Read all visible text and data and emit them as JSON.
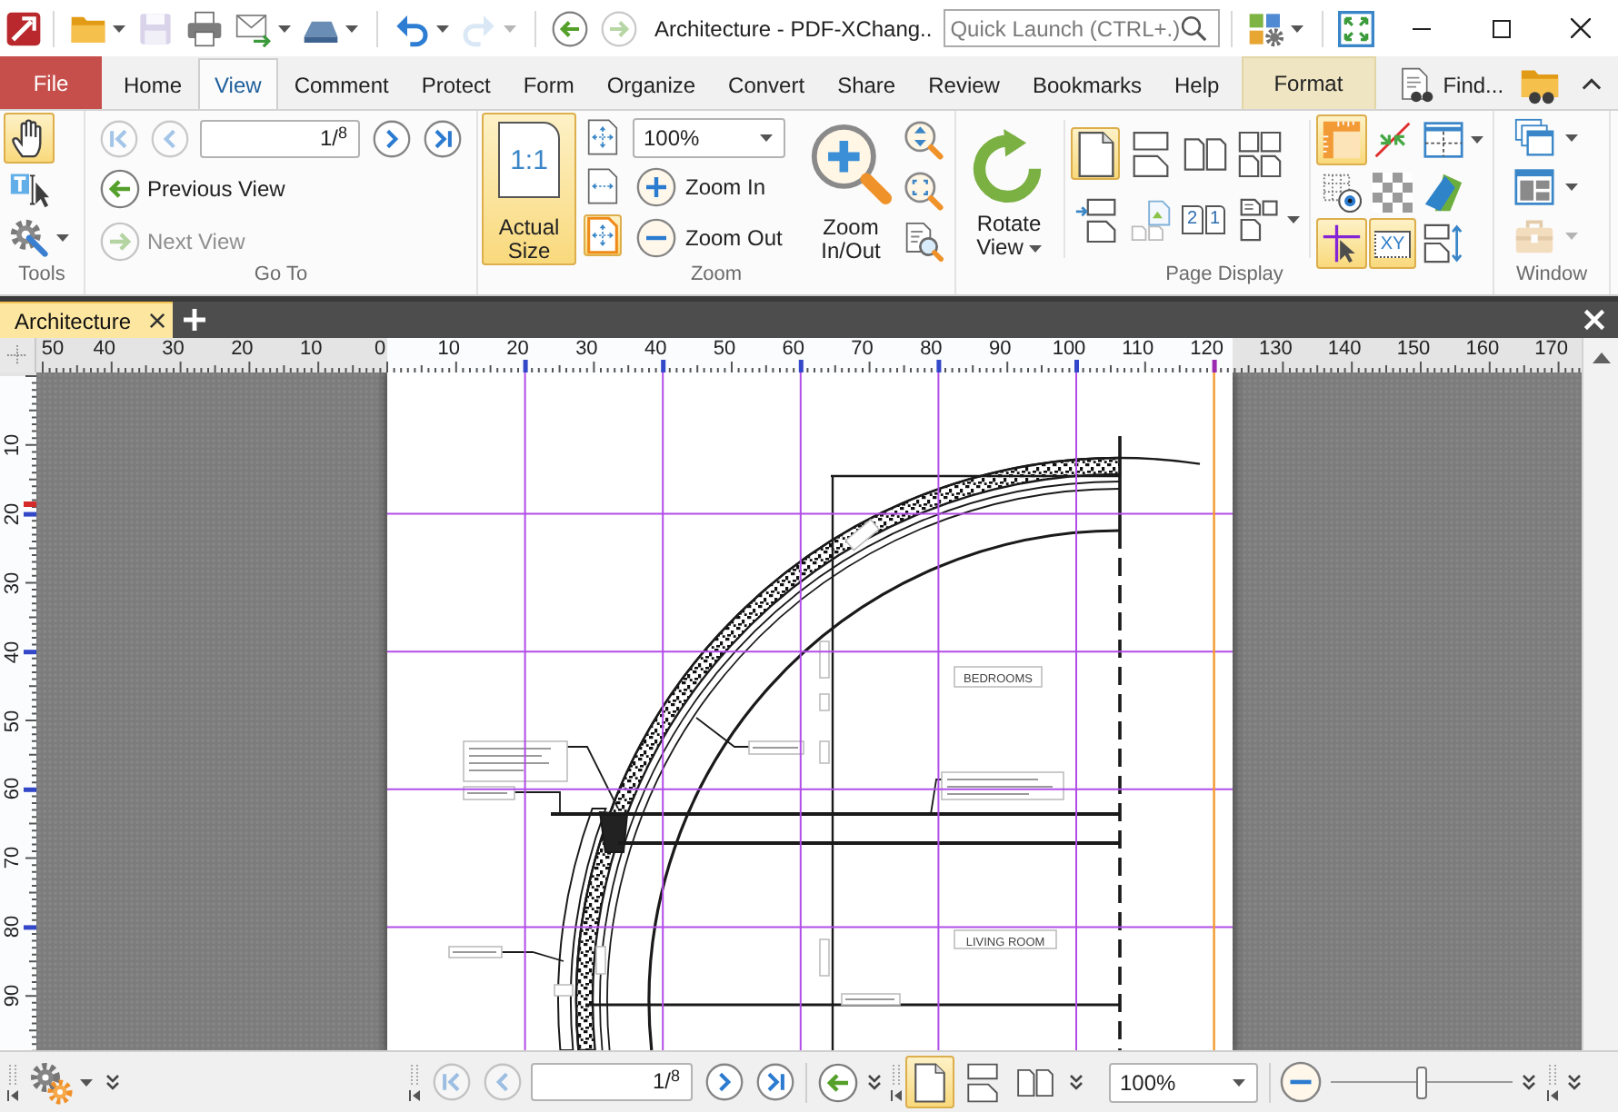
{
  "title_bar": {
    "quick_access": [
      {
        "kind": "open",
        "disabled": false
      },
      {
        "kind": "save",
        "disabled": true
      },
      {
        "kind": "print",
        "disabled": false
      },
      {
        "kind": "email",
        "disabled": false
      },
      {
        "kind": "scan",
        "disabled": false
      },
      {
        "kind": "undo",
        "disabled": false
      },
      {
        "kind": "redo",
        "disabled": true
      },
      {
        "kind": "back",
        "disabled": false
      },
      {
        "kind": "forward",
        "disabled": true
      }
    ],
    "title": "Architecture - PDF-XChang..",
    "quick_launch": {
      "placeholder": "Quick Launch (CTRL+.)"
    }
  },
  "ribbon_tabs": [
    {
      "label": "File",
      "kind": "file",
      "selected": false
    },
    {
      "label": "Home",
      "kind": "tab",
      "selected": false
    },
    {
      "label": "View",
      "kind": "tab",
      "selected": true
    },
    {
      "label": "Comment",
      "kind": "tab",
      "selected": false
    },
    {
      "label": "Protect",
      "kind": "tab",
      "selected": false
    },
    {
      "label": "Form",
      "kind": "tab",
      "selected": false
    },
    {
      "label": "Organize",
      "kind": "tab",
      "selected": false
    },
    {
      "label": "Convert",
      "kind": "tab",
      "selected": false
    },
    {
      "label": "Share",
      "kind": "tab",
      "selected": false
    },
    {
      "label": "Review",
      "kind": "tab",
      "selected": false
    },
    {
      "label": "Bookmarks",
      "kind": "tab",
      "selected": false
    },
    {
      "label": "Help",
      "kind": "tab",
      "selected": false
    },
    {
      "label": "Format",
      "kind": "contextual",
      "selected": false
    }
  ],
  "find": {
    "label": "Find..."
  },
  "ribbon": {
    "tools": {
      "label": "Tools",
      "buttons": [
        {
          "kind": "hand",
          "selected": true
        },
        {
          "kind": "select-text",
          "selected": false
        },
        {
          "kind": "settings",
          "selected": false
        }
      ]
    },
    "go_to": {
      "label": "Go To",
      "nav": [
        {
          "kind": "first",
          "disabled": true
        },
        {
          "kind": "previous",
          "disabled": true
        },
        {
          "kind": "next",
          "disabled": false
        },
        {
          "kind": "last",
          "disabled": false
        }
      ],
      "page": "1/$^{8}$",
      "history": [
        {
          "label": "Previous View",
          "disabled": false
        },
        {
          "label": "Next View",
          "disabled": true
        }
      ]
    },
    "zoom": {
      "label": "Zoom",
      "actual_size": {
        "label": "Actual Size",
        "icon_text": "1:1",
        "selected": true
      },
      "fit": [
        {
          "kind": "page",
          "selected": false
        },
        {
          "kind": "width",
          "selected": false
        },
        {
          "kind": "visible",
          "selected": true
        }
      ],
      "zoom_level": "100%",
      "zoom_in": "Zoom In",
      "zoom_out": "Zoom Out",
      "zoom_in_out": "Zoom In/Out"
    },
    "page_display": {
      "label": "Page Display",
      "rotate": "Rotate View",
      "layouts": [
        {
          "kind": "single",
          "selected": true
        },
        {
          "kind": "continuous",
          "selected": false
        },
        {
          "kind": "facing",
          "selected": false
        },
        {
          "kind": "continuous-facing",
          "selected": false
        }
      ],
      "page_numbers": [
        "2",
        "1"
      ],
      "view_tools": [
        {
          "kind": "rulers",
          "selected": true
        },
        {
          "kind": "measure",
          "selected": false
        },
        {
          "kind": "grid",
          "selected": false
        },
        {
          "kind": "transparency",
          "selected": false
        },
        {
          "kind": "checkerboard",
          "selected": false
        },
        {
          "kind": "color",
          "selected": false
        },
        {
          "kind": "crosshair",
          "selected": true
        },
        {
          "kind": "coordinates",
          "selected": true,
          "text": "XY"
        },
        {
          "kind": "page-height",
          "selected": false
        }
      ]
    },
    "window": {
      "label": "Window",
      "buttons": [
        {
          "kind": "cascade",
          "disabled": false
        },
        {
          "kind": "tile",
          "disabled": false
        },
        {
          "kind": "toolbox",
          "disabled": true
        }
      ]
    }
  },
  "document_tabs": [
    {
      "label": "Architecture",
      "selected": true
    }
  ],
  "rulers": {
    "horizontal": [
      "50",
      "40",
      "30",
      "20",
      "10",
      "0",
      "10",
      "20",
      "30",
      "40",
      "50",
      "60",
      "70",
      "80",
      "90",
      "100",
      "110",
      "120",
      "130",
      "140",
      "150",
      "160",
      "170"
    ],
    "vertical": [
      "10",
      "20",
      "30",
      "40",
      "50",
      "60",
      "70",
      "80",
      "90"
    ]
  },
  "page": {
    "room_labels": [
      "BEDROOMS",
      "LIVING ROOM"
    ]
  },
  "status_bar": {
    "nav": [
      {
        "kind": "first",
        "disabled": true
      },
      {
        "kind": "previous",
        "disabled": true
      },
      {
        "kind": "next",
        "disabled": false
      },
      {
        "kind": "last",
        "disabled": false
      }
    ],
    "page": "1/$^{8}$",
    "layouts": [
      {
        "kind": "single",
        "selected": true
      },
      {
        "kind": "continuous",
        "selected": false
      },
      {
        "kind": "facing",
        "selected": false
      }
    ],
    "zoom_level": "100%",
    "zoom_slider": {
      "level": 0.5
    }
  }
}
